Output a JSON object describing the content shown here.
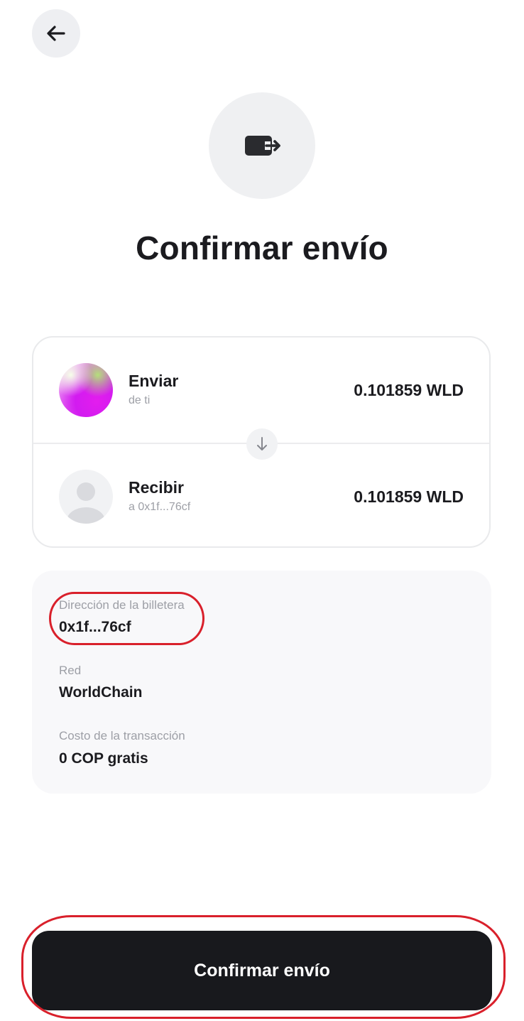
{
  "header": {
    "back_icon": "arrow-left-icon",
    "hero_icon": "wallet-send-icon"
  },
  "title": "Confirmar envío",
  "transfer": {
    "send": {
      "label": "Enviar",
      "sub": "de ti",
      "amount": "0.101859 WLD",
      "avatar_icon": "gradient-avatar"
    },
    "arrow_icon": "arrow-down-icon",
    "receive": {
      "label": "Recibir",
      "sub": "a 0x1f...76cf",
      "amount": "0.101859 WLD",
      "avatar_icon": "user-placeholder-icon"
    }
  },
  "details": [
    {
      "label": "Dirección de la billetera",
      "value": "0x1f...76cf"
    },
    {
      "label": "Red",
      "value": "WorldChain"
    },
    {
      "label": "Costo de la transacción",
      "value": "0 COP gratis"
    }
  ],
  "confirm_button": "Confirmar envío",
  "colors": {
    "button_bg": "#18191d",
    "highlight": "#d9202b",
    "panel_bg": "#f8f8fa",
    "muted_text": "#9d9fa6"
  }
}
